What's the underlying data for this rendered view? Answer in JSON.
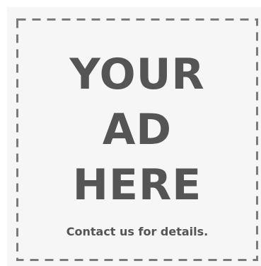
{
  "ad": {
    "headline_lines": [
      "YOUR",
      "AD",
      "HERE"
    ],
    "tagline": "Contact us for details."
  },
  "colors": {
    "panel_background": "#f6f6f6",
    "text": "#555555",
    "dashed_border": "#7a7a7a"
  }
}
